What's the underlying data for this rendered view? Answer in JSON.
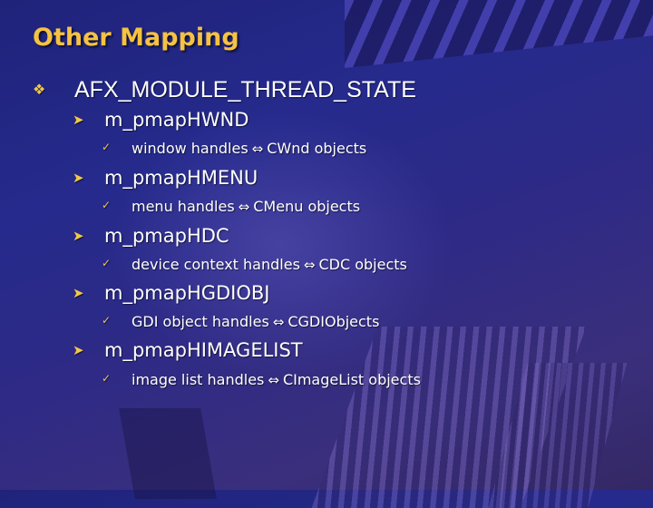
{
  "slide": {
    "title": "Other Mapping",
    "bullet_icons": {
      "level1": "diamond-cluster-icon",
      "level2": "arrowhead-icon",
      "level3": "checkmark-icon"
    },
    "colors": {
      "title": "#f5c242",
      "bullet": "#f2c84a",
      "text": "#ffffff",
      "background": "#262a88"
    },
    "root": {
      "label": "AFX_MODULE_THREAD_STATE",
      "members": [
        {
          "name": "m_pmapHWND",
          "detail_left": "window handles",
          "arrow": "⇔",
          "detail_right": "CWnd objects"
        },
        {
          "name": "m_pmapHMENU",
          "detail_left": "menu handles",
          "arrow": "⇔",
          "detail_right": "CMenu objects"
        },
        {
          "name": "m_pmapHDC",
          "detail_left": "device context handles",
          "arrow": "⇔",
          "detail_right": "CDC objects"
        },
        {
          "name": "m_pmapHGDIOBJ",
          "detail_left": "GDI object handles",
          "arrow": "⇔",
          "detail_right": "CGDIObjects"
        },
        {
          "name": "m_pmapHIMAGELIST",
          "detail_left": "image list handles",
          "arrow": "⇔",
          "detail_right": "CImageList objects"
        }
      ]
    }
  }
}
